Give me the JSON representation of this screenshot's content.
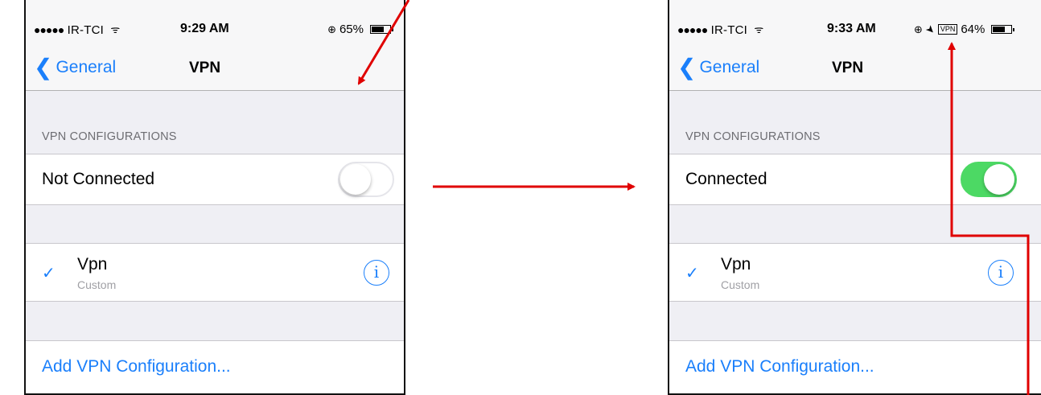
{
  "left_screen": {
    "status": {
      "carrier": "IR-TCI",
      "time": "9:29 AM",
      "battery": "65%"
    },
    "nav": {
      "back_label": "General",
      "title": "VPN"
    },
    "section_header": "VPN CONFIGURATIONS",
    "connection_status": "Not Connected",
    "vpn_switch_on": false,
    "config": {
      "name": "Vpn",
      "type": "Custom"
    },
    "add_label": "Add VPN Configuration..."
  },
  "right_screen": {
    "status": {
      "carrier": "IR-TCI",
      "time": "9:33 AM",
      "vpn_badge": "VPN",
      "battery": "64%"
    },
    "nav": {
      "back_label": "General",
      "title": "VPN"
    },
    "section_header": "VPN CONFIGURATIONS",
    "connection_status": "Connected",
    "vpn_switch_on": true,
    "config": {
      "name": "Vpn",
      "type": "Custom"
    },
    "add_label": "Add VPN Configuration..."
  },
  "colors": {
    "ios_blue": "#1a7ffb",
    "switch_on_green": "#4cd964",
    "annotation_arrow": "#e00000"
  },
  "icons": {
    "signal": "signal-dots-icon",
    "wifi": "wifi-icon",
    "rotation_lock": "rotation-lock-icon",
    "location": "location-arrow-icon",
    "battery": "battery-icon",
    "back": "chevron-left-icon",
    "selected": "checkmark-icon",
    "info": "info-icon"
  }
}
